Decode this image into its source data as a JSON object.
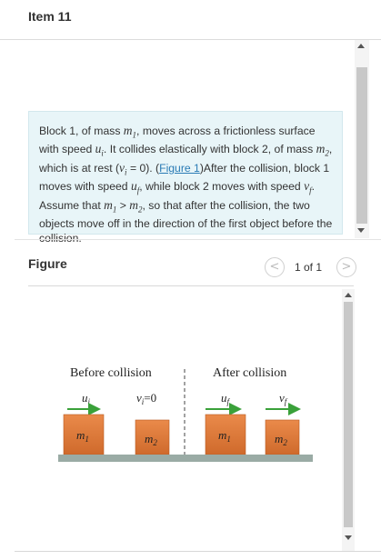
{
  "item": {
    "title": "Item 11"
  },
  "problem": {
    "s1": "Block 1, of mass ",
    "s2": ", moves across a frictionless surface with speed ",
    "s3": ". It collides elastically with block 2, of mass ",
    "s4": ", which is at rest (",
    "s5": " = 0). (",
    "link": "Figure 1",
    "s6": ")After the collision, block 1 moves with speed ",
    "s7": ", while block 2 moves with speed ",
    "s8": ". Assume that ",
    "s9": " > ",
    "s10": ", so that after the collision, the two objects move off in the direction of the first object before the collision.",
    "m1": "m",
    "m1_sub": "1",
    "m2": "m",
    "m2_sub": "2",
    "ui": "u",
    "ui_sub": "i",
    "vi": "v",
    "vi_sub": "i",
    "uf": "u",
    "uf_sub": "f",
    "vf": "v",
    "vf_sub": "f"
  },
  "figure": {
    "label": "Figure",
    "page_indicator": "1 of 1",
    "prev_icon": "<",
    "next_icon": ">",
    "before_caption": "Before collision",
    "after_caption": "After collision",
    "before_u": "u",
    "before_u_sub": "i",
    "before_v": "v",
    "before_v_sub": "i",
    "before_v_value": "=0",
    "after_u": "u",
    "after_u_sub": "f",
    "after_v": "v",
    "after_v_sub": "f",
    "block1": "m",
    "block1_sub": "1",
    "block2": "m",
    "block2_sub": "2"
  },
  "colors": {
    "block_fill": "#e07b3c",
    "arrow_green": "#3aa13a",
    "ground": "#9aaba5",
    "link": "#2a7bb5",
    "box_bg": "#e8f5f8"
  }
}
